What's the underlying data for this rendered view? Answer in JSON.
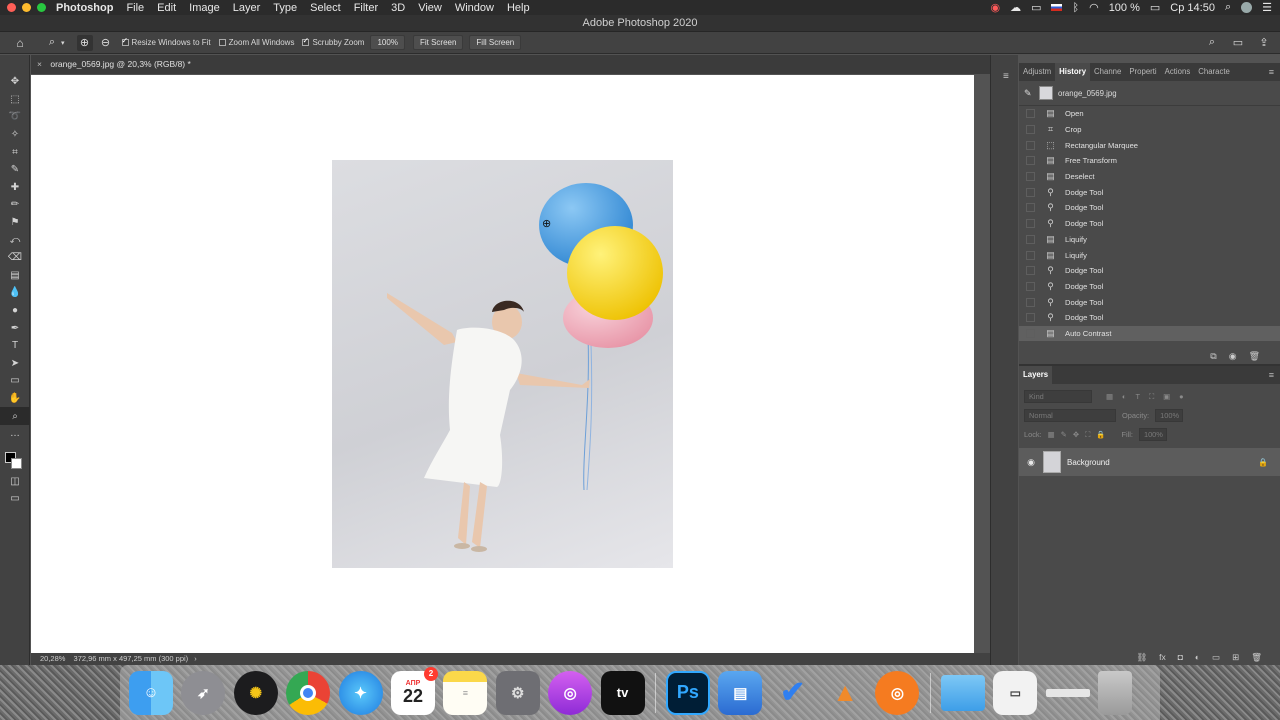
{
  "menubar": {
    "app_name": "Photoshop",
    "items": [
      "File",
      "Edit",
      "Image",
      "Layer",
      "Type",
      "Select",
      "Filter",
      "3D",
      "View",
      "Window",
      "Help"
    ],
    "battery": "100 %",
    "clock": "Ср 14:50"
  },
  "window_title": "Adobe Photoshop 2020",
  "options": {
    "resize_windows": "Resize Windows to Fit",
    "zoom_all": "Zoom All Windows",
    "scrubby_zoom": "Scrubby Zoom",
    "zoom_100": "100%",
    "fit_screen": "Fit Screen",
    "fill_screen": "Fill Screen"
  },
  "document": {
    "tab_label": "orange_0569.jpg @ 20,3% (RGB/8) *",
    "zoom_status": "20,28%",
    "size_status": "372,96 mm x 497,25 mm (300 ppi)"
  },
  "history_panel": {
    "tabs": [
      "Adjustm",
      "History",
      "Channe",
      "Properti",
      "Actions",
      "Characte"
    ],
    "snapshot_name": "orange_0569.jpg",
    "items": [
      {
        "label": "Open",
        "icon": "doc"
      },
      {
        "label": "Crop",
        "icon": "crop"
      },
      {
        "label": "Rectangular Marquee",
        "icon": "marquee"
      },
      {
        "label": "Free Transform",
        "icon": "doc"
      },
      {
        "label": "Deselect",
        "icon": "doc"
      },
      {
        "label": "Dodge Tool",
        "icon": "dodge"
      },
      {
        "label": "Dodge Tool",
        "icon": "dodge"
      },
      {
        "label": "Dodge Tool",
        "icon": "dodge"
      },
      {
        "label": "Liquify",
        "icon": "doc"
      },
      {
        "label": "Liquify",
        "icon": "doc"
      },
      {
        "label": "Dodge Tool",
        "icon": "dodge"
      },
      {
        "label": "Dodge Tool",
        "icon": "dodge"
      },
      {
        "label": "Dodge Tool",
        "icon": "dodge"
      },
      {
        "label": "Dodge Tool",
        "icon": "dodge"
      },
      {
        "label": "Auto Contrast",
        "icon": "doc"
      }
    ]
  },
  "layers_panel": {
    "title": "Layers",
    "kind_filter": "Kind",
    "blend_mode": "Normal",
    "opacity_label": "Opacity:",
    "opacity_value": "100%",
    "lock_label": "Lock:",
    "fill_label": "Fill:",
    "fill_value": "100%",
    "layer_name": "Background"
  },
  "dock": {
    "calendar_month": "АПР",
    "calendar_day": "22",
    "calendar_badge": "2",
    "ps_label": "Ps",
    "tv_label": "tv"
  },
  "colors": {
    "balloon_blue": "#4a9ee0",
    "balloon_yellow": "#f5d21a",
    "balloon_pink": "#eeaab8"
  }
}
